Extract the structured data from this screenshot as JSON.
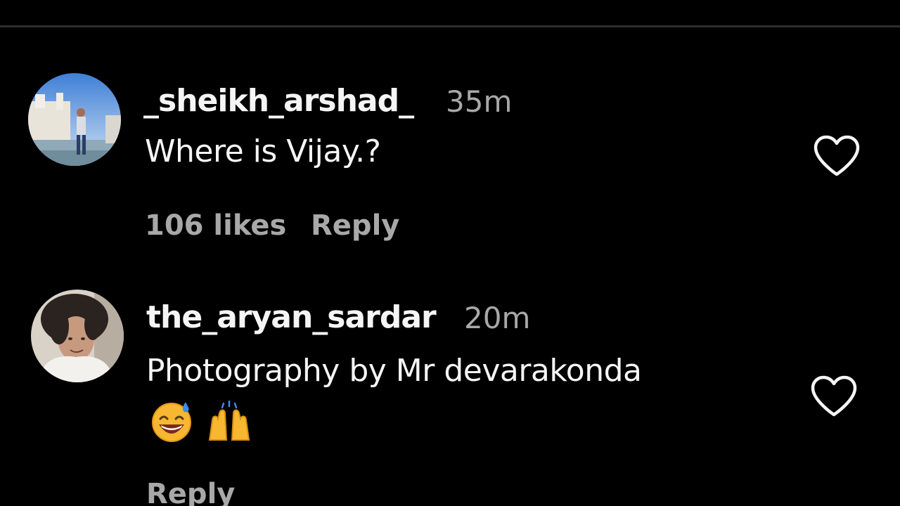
{
  "comments": [
    {
      "username": "_sheikh_arshad_",
      "time": "35m",
      "text": "Where is Vijay.?",
      "likes_label": "106 likes",
      "reply_label": "Reply"
    },
    {
      "username": "the_aryan_sardar",
      "time": "20m",
      "text": "Photography by Mr devarakonda",
      "emojis": [
        "grinning-sweat-emoji",
        "raising-hands-emoji"
      ],
      "reply_label": "Reply"
    }
  ],
  "colors": {
    "background": "#000000",
    "primary_text": "#f5f5f5",
    "secondary_text": "#a8a8a8"
  }
}
